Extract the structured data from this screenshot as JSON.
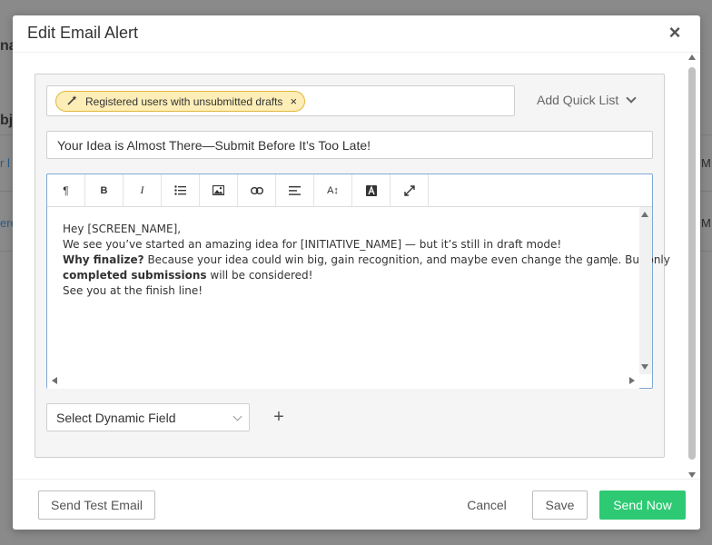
{
  "background": {
    "fragments": [
      "na",
      "bj",
      "r l",
      "M",
      "ere",
      "M"
    ]
  },
  "modal": {
    "title": "Edit Email Alert",
    "close_icon": "close-icon"
  },
  "recipients": {
    "tag_icon": "magic-wand-icon",
    "tag_label": "Registered users with unsubmitted drafts",
    "tag_remove": "×",
    "quick_list_label": "Add Quick List"
  },
  "subject": {
    "value": "Your Idea is Almost There—Submit Before It’s Too Late!"
  },
  "toolbar": {
    "buttons": [
      {
        "name": "paragraph-icon",
        "glyph": "¶"
      },
      {
        "name": "bold-icon",
        "glyph": "B"
      },
      {
        "name": "italic-icon",
        "glyph": "I"
      },
      {
        "name": "bullet-list-icon",
        "glyph": ""
      },
      {
        "name": "image-icon",
        "glyph": ""
      },
      {
        "name": "link-icon",
        "glyph": ""
      },
      {
        "name": "align-icon",
        "glyph": ""
      },
      {
        "name": "font-size-icon",
        "glyph": "A↕"
      },
      {
        "name": "font-color-icon",
        "glyph": "A"
      },
      {
        "name": "fullscreen-icon",
        "glyph": "⤢"
      }
    ]
  },
  "body": {
    "line1": "Hey [SCREEN_NAME],",
    "line2": "We see you’ve started an amazing idea for [INITIATIVE_NAME] — but it’s still in draft mode!",
    "line3_bold": "Why finalize?",
    "line3_rest_a": " Because your idea could win big, gain recognition, and maybe even change the gam",
    "line3_rest_b": "e. But only",
    "line4_bold": "completed submissions",
    "line4_rest": " will be considered!",
    "line5": "See you at the finish line!"
  },
  "dynamic_field": {
    "placeholder": "Select Dynamic Field",
    "add_icon": "plus-icon",
    "add_glyph": "+"
  },
  "footer": {
    "send_test_label": "Send Test Email",
    "cancel_label": "Cancel",
    "save_label": "Save",
    "send_now_label": "Send Now"
  },
  "colors": {
    "primary_green": "#2dca73",
    "tag_background": "#fdeeb7",
    "tag_border": "#e2b73c",
    "editor_focus_border": "#7fa9d6",
    "overlay": "#8a8a8a"
  }
}
